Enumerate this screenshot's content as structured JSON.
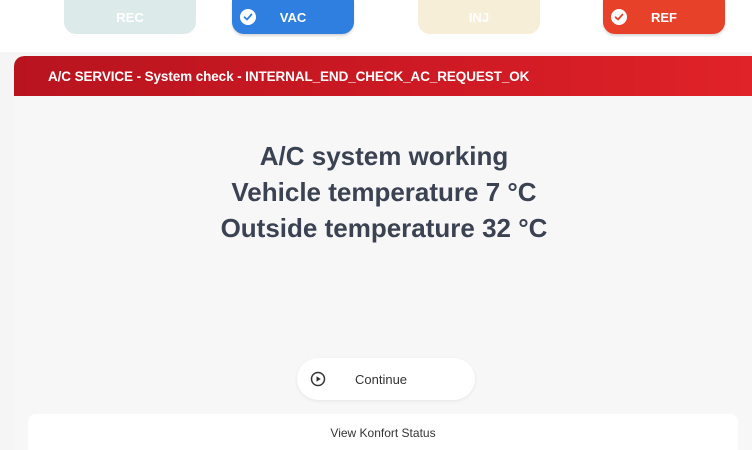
{
  "steps": [
    {
      "label": "REC",
      "state": "inactive",
      "color": "#dcebea"
    },
    {
      "label": "VAC",
      "state": "done",
      "color": "#2f7fe0"
    },
    {
      "label": "INJ",
      "state": "inactive",
      "color": "#f6eed6"
    },
    {
      "label": "REF",
      "state": "done",
      "color": "#e8412a"
    }
  ],
  "header": {
    "title": "A/C SERVICE - System check - INTERNAL_END_CHECK_AC_REQUEST_OK",
    "color": "#cf1a24"
  },
  "message": {
    "line1": "A/C system working",
    "line2": "Vehicle temperature 7 °C",
    "line3": "Outside temperature 32 °C"
  },
  "actions": {
    "continue_label": "Continue",
    "continue_icon": "play-circle-icon",
    "konfort_label": "View Konfort Status"
  }
}
